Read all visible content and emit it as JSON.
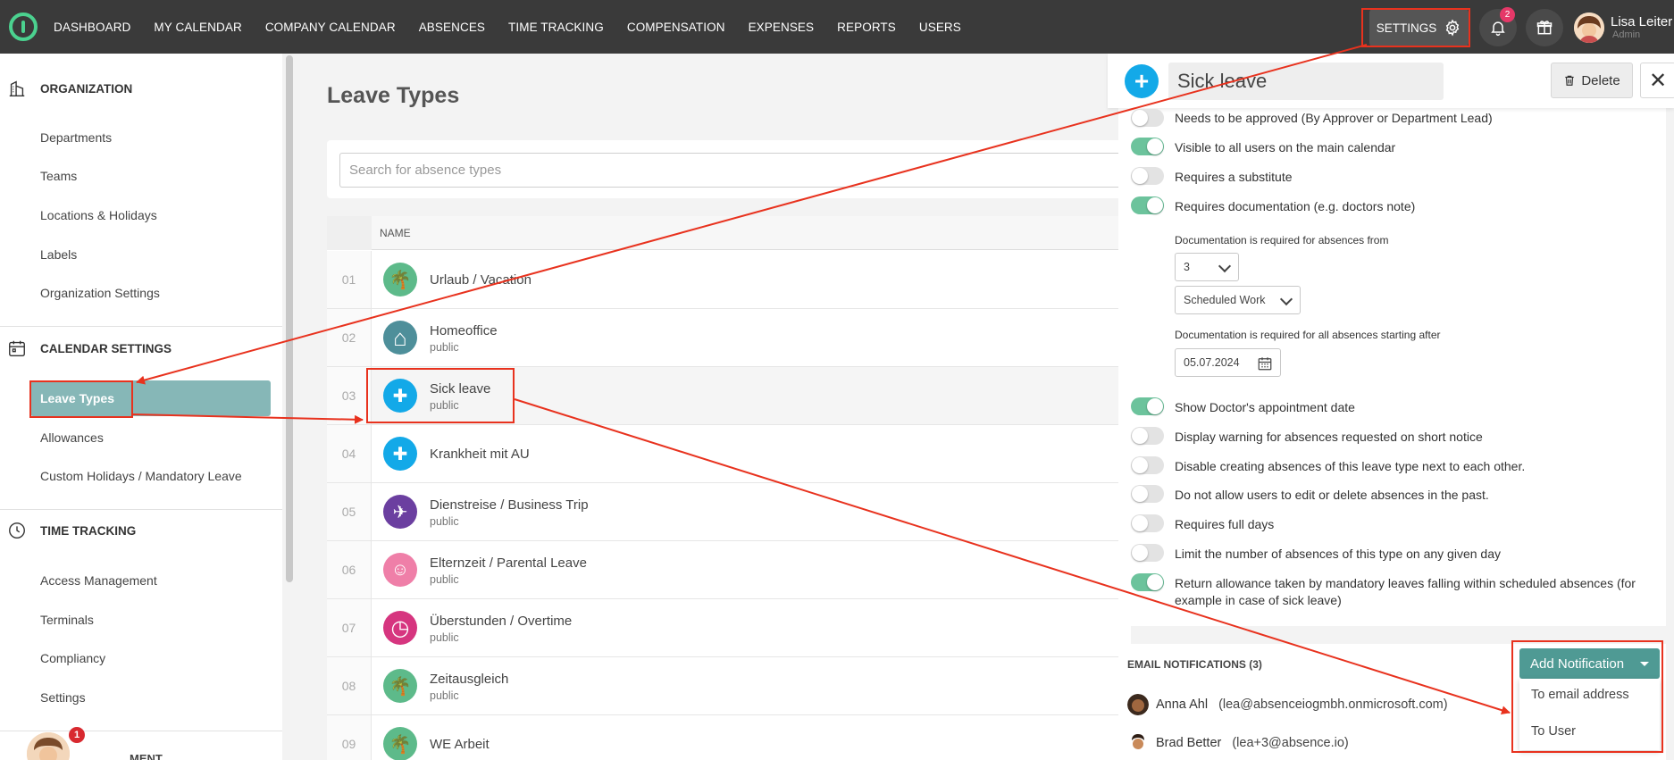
{
  "nav": {
    "links": [
      "DASHBOARD",
      "MY CALENDAR",
      "COMPANY CALENDAR",
      "ABSENCES",
      "TIME TRACKING",
      "COMPENSATION",
      "EXPENSES",
      "REPORTS",
      "USERS"
    ],
    "settings_label": "SETTINGS",
    "notification_count": "2",
    "user_name": "Lisa Leiter",
    "user_role": "Admin"
  },
  "sidebar": {
    "organization": {
      "title": "ORGANIZATION",
      "items": [
        "Departments",
        "Teams",
        "Locations & Holidays",
        "Labels",
        "Organization Settings"
      ]
    },
    "calendar_settings": {
      "title": "CALENDAR SETTINGS",
      "active_item": "Leave Types",
      "items": [
        "Allowances",
        "Custom Holidays / Mandatory Leave"
      ]
    },
    "time_tracking": {
      "title": "TIME TRACKING",
      "items": [
        "Access Management",
        "Terminals",
        "Compliancy",
        "Settings"
      ]
    },
    "partial_heading": "MENT",
    "chat_badge": "1"
  },
  "main": {
    "title": "Leave Types",
    "search_placeholder": "Search for absence types",
    "column_name": "NAME",
    "rows": [
      {
        "num": "01",
        "name": "Urlaub / Vacation",
        "sub": "",
        "color": "#5dba8a",
        "icon": "palm-tree-icon",
        "glyph": "🌴"
      },
      {
        "num": "02",
        "name": "Homeoffice",
        "sub": "public",
        "color": "#4e8f9a",
        "icon": "home-icon",
        "glyph": "⌂"
      },
      {
        "num": "03",
        "name": "Sick leave",
        "sub": "public",
        "color": "#13a9e8",
        "icon": "plus-icon",
        "glyph": "✚"
      },
      {
        "num": "04",
        "name": "Krankheit mit AU",
        "sub": "",
        "color": "#13a9e8",
        "icon": "plus-icon",
        "glyph": "✚"
      },
      {
        "num": "05",
        "name": "Dienstreise / Business Trip",
        "sub": "public",
        "color": "#6b3fa0",
        "icon": "airplane-icon",
        "glyph": "✈"
      },
      {
        "num": "06",
        "name": "Elternzeit / Parental Leave",
        "sub": "public",
        "color": "#ef7fa8",
        "icon": "baby-icon",
        "glyph": "☺"
      },
      {
        "num": "07",
        "name": "Überstunden / Overtime",
        "sub": "public",
        "color": "#d6357f",
        "icon": "clock-icon",
        "glyph": "◷"
      },
      {
        "num": "08",
        "name": "Zeitausgleich",
        "sub": "public",
        "color": "#5dba8a",
        "icon": "palm-tree-icon",
        "glyph": "🌴"
      },
      {
        "num": "09",
        "name": "WE Arbeit",
        "sub": "",
        "color": "#5dba8a",
        "icon": "palm-tree-icon",
        "glyph": "🌴"
      }
    ]
  },
  "panel": {
    "title": "Sick leave",
    "delete_label": "Delete",
    "options": [
      {
        "label": "Needs to be approved (By Approver or Department Lead)",
        "on": false
      },
      {
        "label": "Visible to all users on the main calendar",
        "on": true
      },
      {
        "label": "Requires a substitute",
        "on": false
      },
      {
        "label": "Requires documentation (e.g. doctors note)",
        "on": true
      }
    ],
    "doc_required_from_label": "Documentation is required for absences from",
    "doc_days_value": "3",
    "doc_unit_value": "Scheduled Work",
    "doc_required_after_label": "Documentation is required for all absences starting after",
    "doc_date_value": "05.07.2024",
    "options2": [
      {
        "label": "Show Doctor's appointment date",
        "on": true
      },
      {
        "label": "Display warning for absences requested on short notice",
        "on": false
      },
      {
        "label": "Disable creating absences of this leave type next to each other.",
        "on": false
      },
      {
        "label": "Do not allow users to edit or delete absences in the past.",
        "on": false
      },
      {
        "label": "Requires full days",
        "on": false
      },
      {
        "label": "Limit the number of absences of this type on any given day",
        "on": false
      },
      {
        "label": "Return allowance taken by mandatory leaves falling within scheduled absences (for",
        "label2": "example in case of sick leave)",
        "on": true
      }
    ],
    "notifications": {
      "title": "EMAIL NOTIFICATIONS (3)",
      "add_label": "Add Notification",
      "menu": [
        "To email address",
        "To User"
      ],
      "recipients": [
        {
          "name": "Anna Ahl",
          "email": "(lea@absenceiogmbh.onmicrosoft.com)"
        },
        {
          "name": "Brad Better",
          "email": "(lea+3@absence.io)"
        }
      ]
    }
  },
  "colors": {
    "annotation": "#e8321e",
    "accent": "#86b7b7",
    "toggle_on": "#6cc39c"
  }
}
